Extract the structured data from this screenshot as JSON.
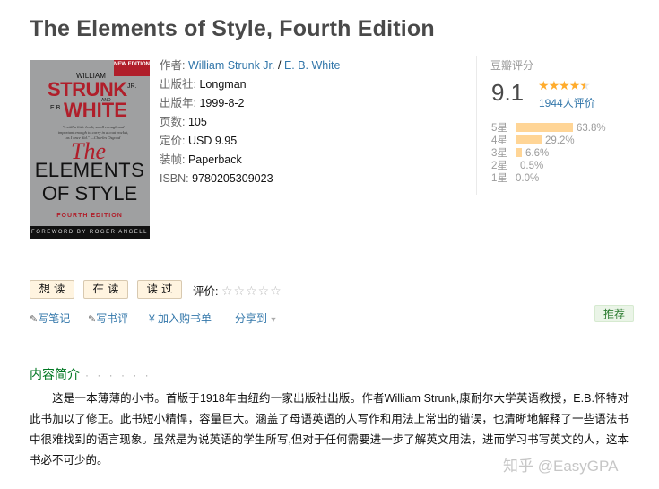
{
  "book": {
    "title": "The Elements of Style, Fourth Edition",
    "cover": {
      "badge": "NEW EDITION",
      "author1_first": "WILLIAM",
      "author1_last": "STRUNK",
      "author1_suffix": "JR.",
      "and_word": "AND",
      "author2_initials": "E.B.",
      "author2_last": "WHITE",
      "quote": "\"...still a little book, small enough and important enough to carry in a coat pocket, as I once did.\" —Charles Osgood",
      "title_the": "The",
      "title_elements": "ELEMENTS",
      "title_of_style": "OF STYLE",
      "edition": "FOURTH EDITION",
      "foreword": "FOREWORD BY ROGER ANGELL"
    },
    "info": [
      {
        "label": "作者:",
        "value": "William Strunk Jr. / E. B. White",
        "link": true
      },
      {
        "label": "出版社:",
        "value": "Longman",
        "link": false
      },
      {
        "label": "出版年:",
        "value": "1999-8-2",
        "link": false
      },
      {
        "label": "页数:",
        "value": "105",
        "link": false
      },
      {
        "label": "定价:",
        "value": "USD 9.95",
        "link": false
      },
      {
        "label": "装帧:",
        "value": "Paperback",
        "link": false
      },
      {
        "label": "ISBN:",
        "value": "9780205309023",
        "link": false
      }
    ],
    "author_a": "William Strunk Jr.",
    "author_sep": " / ",
    "author_b": "E. B. White"
  },
  "rating": {
    "heading": "豆瓣评分",
    "score": "9.1",
    "stars_filled": 4.5,
    "count_text": "1944人评价",
    "distribution": [
      {
        "label": "5星",
        "percent": 63.8,
        "text": "63.8%"
      },
      {
        "label": "4星",
        "percent": 29.2,
        "text": "29.2%"
      },
      {
        "label": "3星",
        "percent": 6.6,
        "text": "6.6%"
      },
      {
        "label": "2星",
        "percent": 0.5,
        "text": "0.5%"
      },
      {
        "label": "1星",
        "percent": 0.0,
        "text": "0.0%"
      }
    ]
  },
  "actions": {
    "want": "想读",
    "reading": "在读",
    "read": "读过",
    "rate_label": "评价:",
    "rate_stars": "☆☆☆☆☆"
  },
  "links": {
    "note": "写笔记",
    "review": "写书评",
    "buy": "加入购书单",
    "share": "分享到",
    "recommend": "推荐"
  },
  "intro": {
    "heading": "内容简介",
    "dots": "· · · · · ·",
    "text": "这是一本薄薄的小书。首版于1918年由纽约一家出版社出版。作者William Strunk,康耐尔大学英语教授，E.B.怀特对此书加以了修正。此书短小精悍，容量巨大。涵盖了母语英语的人写作和用法上常出的错误，也清晰地解释了一些语法书中很难找到的语言现象。虽然是为说英语的学生所写,但对于任何需要进一步了解英文用法，进而学习书写英文的人，这本书必不可少的。"
  },
  "watermark": "知乎 @EasyGPA",
  "colors": {
    "link": "#3377aa",
    "star": "#ffac2d",
    "bar": "#ffd596",
    "intro_heading": "#007722"
  }
}
